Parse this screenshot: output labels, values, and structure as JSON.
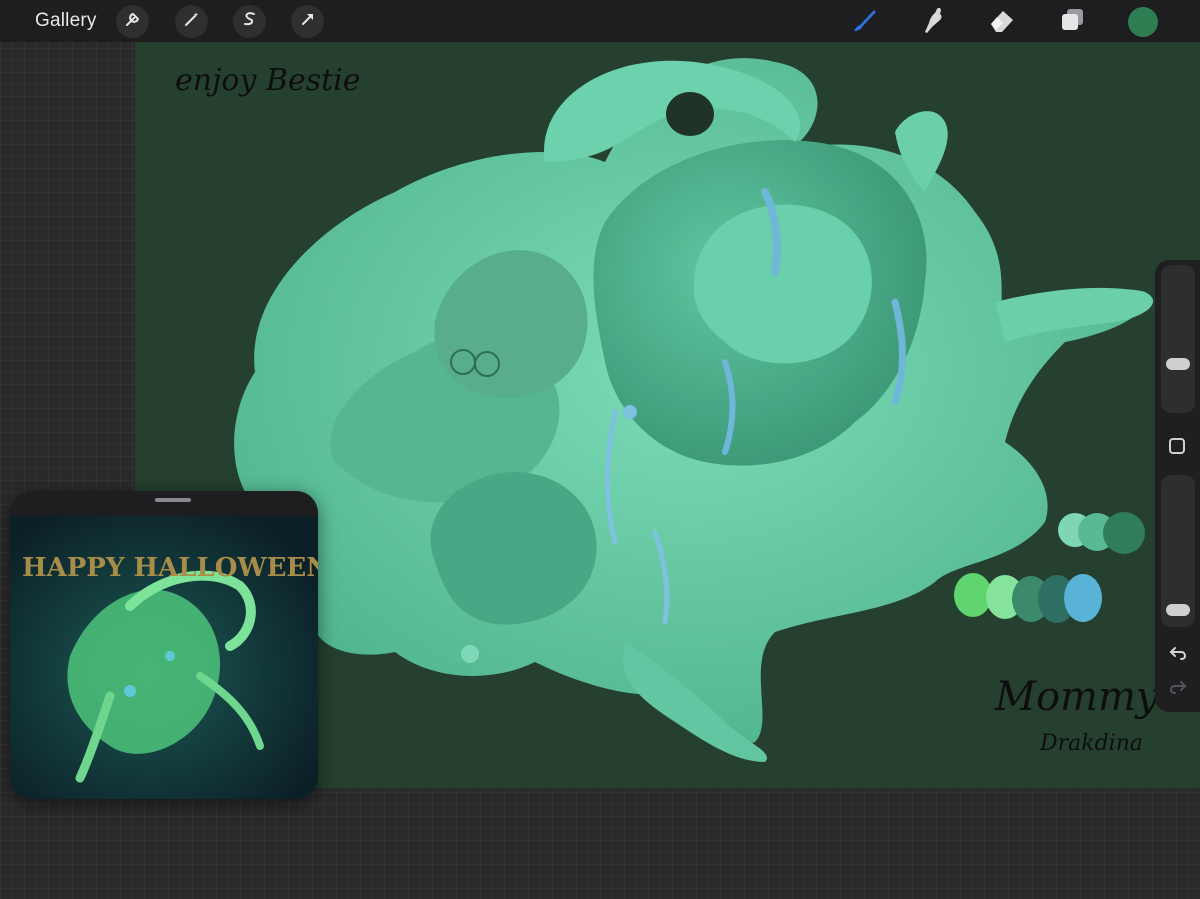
{
  "toolbar": {
    "gallery_label": "Gallery",
    "left_tools": [
      "wrench-icon",
      "magic-wand-icon",
      "selection-icon",
      "transform-arrow-icon"
    ],
    "right_tools": [
      "brush-icon",
      "smudge-icon",
      "eraser-icon",
      "layers-icon"
    ],
    "current_color": "#2f7d52",
    "active_tool_color": "#2f6fe0"
  },
  "canvas": {
    "background_color": "#25402f",
    "handwritten_note": "enjoy Bestie",
    "signature_line1": "Mommy",
    "signature_line2": "Drakdina",
    "palette_top": [
      "#7fd6b6",
      "#58b994",
      "#2f7d5a"
    ],
    "palette_bottom": [
      "#5fd46f",
      "#86e39b",
      "#3c8a6c",
      "#2f6e62",
      "#58b3d6"
    ]
  },
  "reference": {
    "title_text": "HAPPY HALLOWEEN!"
  },
  "sidebar": {
    "brush_size_level": 0.3,
    "opacity_level": 0.05
  }
}
